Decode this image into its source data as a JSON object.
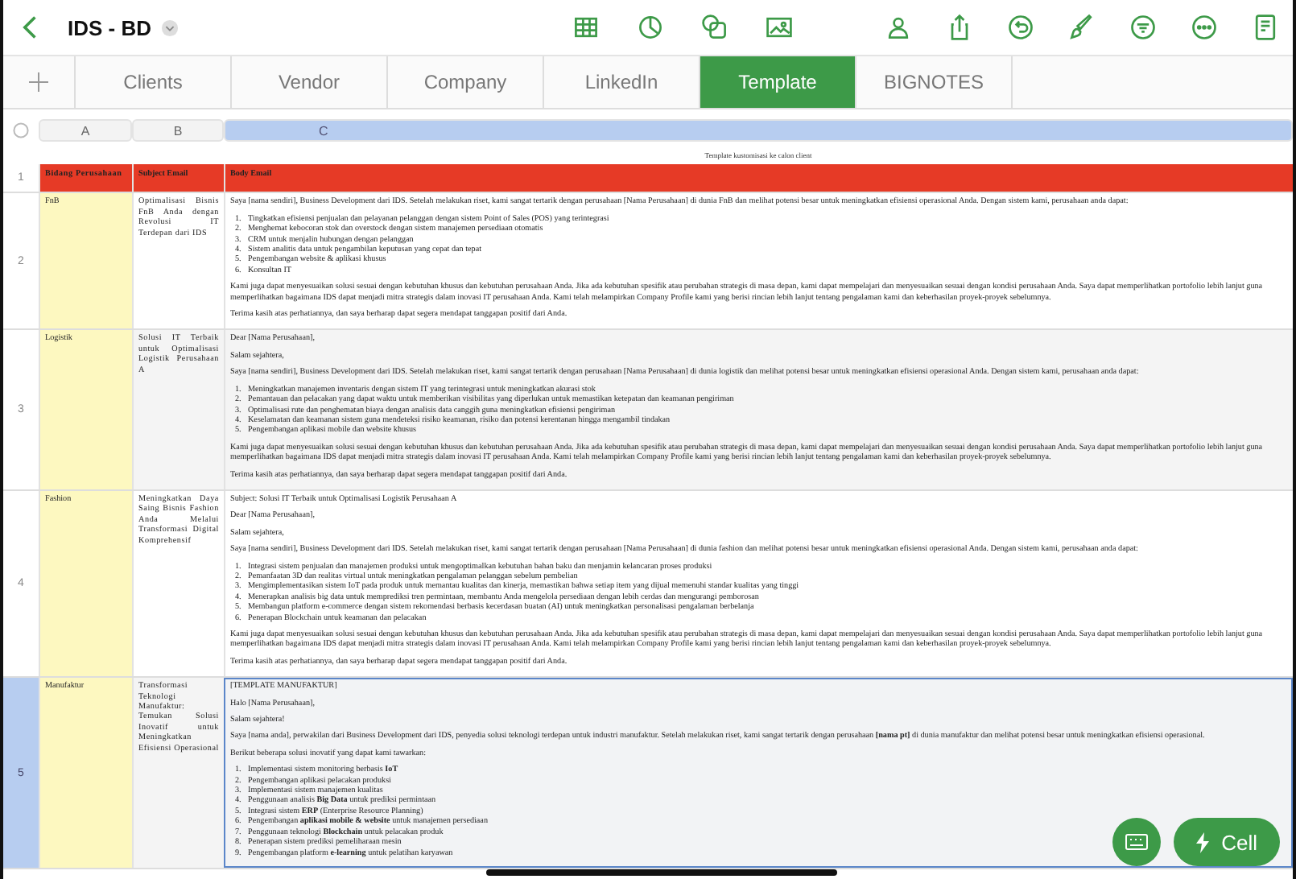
{
  "document": {
    "title": "IDS - BD"
  },
  "tabs": [
    {
      "label": "Clients",
      "selected": false
    },
    {
      "label": "Vendor",
      "selected": false
    },
    {
      "label": "Company",
      "selected": false
    },
    {
      "label": "LinkedIn",
      "selected": false
    },
    {
      "label": "Template",
      "selected": true
    },
    {
      "label": "BIGNOTES",
      "selected": false
    }
  ],
  "columns": [
    {
      "label": "A",
      "selected": false
    },
    {
      "label": "B",
      "selected": false
    },
    {
      "label": "C",
      "selected": true
    }
  ],
  "sheet_title": "Template kustomisasi ke calon client",
  "header": {
    "number": "1",
    "cells": [
      "Bidang Perusahaan",
      "Subject Email",
      "Body Email"
    ]
  },
  "rows": [
    {
      "number": "2",
      "selected": false,
      "editing": false,
      "sector": "FnB",
      "subject": "Optimalisasi Bisnis FnB Anda dengan Revolusi IT Terdepan dari IDS",
      "body": [
        {
          "kind": "para",
          "text": "Saya [nama sendiri], Business Development dari IDS. Setelah melakukan riset, kami sangat tertarik dengan perusahaan [Nama Perusahaan] di dunia FnB dan melihat potensi besar untuk meningkatkan efisiensi operasional Anda. Dengan sistem kami, perusahaan anda dapat:"
        },
        {
          "kind": "list",
          "items": [
            {
              "marker": "1.",
              "text": "Tingkatkan efisiensi penjualan dan pelayanan pelanggan dengan sistem Point of Sales (POS) yang terintegrasi"
            },
            {
              "marker": "2.",
              "text": "Menghemat kebocoran stok dan overstock dengan sistem manajemen persediaan otomatis"
            },
            {
              "marker": "3.",
              "text": "CRM untuk menjalin hubungan dengan pelanggan"
            },
            {
              "marker": "4.",
              "text": "Sistem analitis data untuk pengambilan keputusan yang cepat dan tepat"
            },
            {
              "marker": "5.",
              "text": "Pengembangan website & aplikasi khusus"
            },
            {
              "marker": "6.",
              "text": "Konsultan IT"
            }
          ]
        },
        {
          "kind": "para",
          "text": "Kami juga dapat menyesuaikan solusi sesuai dengan kebutuhan khusus dan kebutuhan perusahaan Anda. Jika ada kebutuhan spesifik atau perubahan strategis di masa depan, kami dapat mempelajari dan menyesuaikan sesuai dengan kondisi perusahaan Anda. Saya dapat memperlihatkan portofolio lebih lanjut guna memperlihatkan bagaimana IDS dapat menjadi mitra strategis dalam inovasi IT perusahaan Anda. Kami telah melampirkan Company Profile kami yang berisi rincian lebih lanjut tentang pengalaman kami dan keberhasilan proyek-proyek sebelumnya."
        },
        {
          "kind": "para",
          "text": "Terima kasih atas perhatiannya, dan saya berharap dapat segera mendapat tanggapan positif dari Anda."
        }
      ]
    },
    {
      "number": "3",
      "selected": false,
      "editing": false,
      "sector": "Logistik",
      "subject": "Solusi IT Terbaik untuk Optimalisasi Logistik Perusahaan A",
      "body": [
        {
          "kind": "para",
          "text": "Dear [Nama Perusahaan],"
        },
        {
          "kind": "para",
          "text": "Salam sejahtera,"
        },
        {
          "kind": "para",
          "text": "Saya [nama sendiri], Business Development dari IDS. Setelah melakukan riset, kami sangat tertarik dengan perusahaan [Nama Perusahaan] di dunia logistik dan melihat potensi besar untuk meningkatkan efisiensi operasional Anda. Dengan sistem kami, perusahaan anda dapat:"
        },
        {
          "kind": "list",
          "items": [
            {
              "marker": "1.",
              "text": "Meningkatkan manajemen inventaris dengan sistem IT yang terintegrasi untuk meningkatkan akurasi stok"
            },
            {
              "marker": "2.",
              "text": "Pemantauan dan pelacakan yang dapat waktu untuk memberikan visibilitas yang diperlukan untuk memastikan ketepatan dan keamanan pengiriman"
            },
            {
              "marker": "3.",
              "text": "Optimalisasi rute dan penghematan biaya dengan analisis data canggih guna meningkatkan efisiensi pengiriman"
            },
            {
              "marker": "4.",
              "text": "Keselamatan dan keamanan sistem guna mendeteksi risiko keamanan, risiko dan potensi kerentanan hingga mengambil tindakan"
            },
            {
              "marker": "5.",
              "text": "Pengembangan aplikasi mobile dan website khusus"
            }
          ]
        },
        {
          "kind": "para",
          "text": "Kami juga dapat menyesuaikan solusi sesuai dengan kebutuhan khusus dan kebutuhan perusahaan Anda. Jika ada kebutuhan spesifik atau perubahan strategis di masa depan, kami dapat mempelajari dan menyesuaikan sesuai dengan kondisi perusahaan Anda. Saya dapat memperlihatkan portofolio lebih lanjut guna memperlihatkan bagaimana IDS dapat menjadi mitra strategis dalam inovasi IT perusahaan Anda. Kami telah melampirkan Company Profile kami yang berisi rincian lebih lanjut tentang pengalaman kami dan keberhasilan proyek-proyek sebelumnya."
        },
        {
          "kind": "para",
          "text": "Terima kasih atas perhatiannya, dan saya berharap dapat segera mendapat tanggapan positif dari Anda."
        }
      ]
    },
    {
      "number": "4",
      "selected": false,
      "editing": false,
      "sector": "Fashion",
      "subject": "Meningkatkan Daya Saing Bisnis Fashion Anda Melalui Transformasi Digital Komprehensif",
      "body": [
        {
          "kind": "para",
          "text": "Subject: Solusi IT Terbaik untuk Optimalisasi Logistik Perusahaan A"
        },
        {
          "kind": "para",
          "text": "Dear [Nama Perusahaan],"
        },
        {
          "kind": "para",
          "text": "Salam sejahtera,"
        },
        {
          "kind": "para",
          "text": "Saya [nama sendiri], Business Development dari IDS. Setelah melakukan riset, kami sangat tertarik dengan perusahaan [Nama Perusahaan] di dunia fashion dan melihat potensi besar untuk meningkatkan efisiensi operasional Anda. Dengan sistem kami, perusahaan anda dapat:"
        },
        {
          "kind": "list",
          "items": [
            {
              "marker": "1.",
              "text": "Integrasi sistem penjualan dan manajemen produksi untuk mengoptimalkan kebutuhan bahan baku dan menjamin kelancaran proses produksi"
            },
            {
              "marker": "2.",
              "text": "Pemanfaatan 3D dan realitas virtual untuk meningkatkan pengalaman pelanggan sebelum pembelian"
            },
            {
              "marker": "3.",
              "text": "Mengimplementasikan sistem IoT pada produk untuk memantau kualitas dan kinerja, memastikan bahwa setiap item yang dijual memenuhi standar kualitas yang tinggi"
            },
            {
              "marker": "4.",
              "text": "Menerapkan analisis big data untuk memprediksi tren permintaan, membantu Anda mengelola persediaan dengan lebih cerdas dan mengurangi pemborosan"
            },
            {
              "marker": "5.",
              "text": "Membangun platform e-commerce dengan sistem rekomendasi berbasis kecerdasan buatan (AI) untuk meningkatkan personalisasi pengalaman berbelanja"
            },
            {
              "marker": "6.",
              "text": "Penerapan Blockchain untuk keamanan dan pelacakan"
            }
          ]
        },
        {
          "kind": "para",
          "text": "Kami juga dapat menyesuaikan solusi sesuai dengan kebutuhan khusus dan kebutuhan perusahaan Anda. Jika ada kebutuhan spesifik atau perubahan strategis di masa depan, kami dapat mempelajari dan menyesuaikan sesuai dengan kondisi perusahaan Anda. Saya dapat memperlihatkan portofolio lebih lanjut guna memperlihatkan bagaimana IDS dapat menjadi mitra strategis dalam inovasi IT perusahaan Anda. Kami telah melampirkan Company Profile kami yang berisi rincian lebih lanjut tentang pengalaman kami dan keberhasilan proyek-proyek sebelumnya."
        },
        {
          "kind": "para",
          "text": "Terima kasih atas perhatiannya, dan saya berharap dapat segera mendapat tanggapan positif dari Anda."
        }
      ]
    },
    {
      "number": "5",
      "selected": true,
      "editing": true,
      "sector": "Manufaktur",
      "subject": "Transformasi Teknologi Manufaktur: Temukan Solusi Inovatif untuk Meningkatkan Efisiensi Operasional",
      "body": [
        {
          "kind": "para",
          "text": "[TEMPLATE MANUFAKTUR]"
        },
        {
          "kind": "para",
          "text": "Halo [Nama Perusahaan],"
        },
        {
          "kind": "para",
          "text": "Salam sejahtera!"
        },
        {
          "kind": "para",
          "text": "Saya [nama anda], perwakilan dari Business Development dari IDS, penyedia solusi teknologi terdepan untuk industri manufaktur. Setelah melakukan riset, kami sangat tertarik dengan perusahaan **[nama pt]** di dunia manufaktur dan melihat potensi besar untuk meningkatkan efisiensi operasional."
        },
        {
          "kind": "para",
          "text": "Berikut beberapa solusi inovatif yang dapat kami tawarkan:"
        },
        {
          "kind": "list",
          "items": [
            {
              "marker": "1.",
              "text": "Implementasi sistem monitoring berbasis **IoT**"
            },
            {
              "marker": "2.",
              "text": "Pengembangan aplikasi pelacakan produksi"
            },
            {
              "marker": "3.",
              "text": "Implementasi sistem manajemen kualitas"
            },
            {
              "marker": "4.",
              "text": "Penggunaan analisis **Big Data** untuk prediksi permintaan"
            },
            {
              "marker": "5.",
              "text": "Integrasi sistem **ERP** (Enterprise Resource Planning)"
            },
            {
              "marker": "6.",
              "text": "Pengembangan **aplikasi mobile & website** untuk manajemen persediaan"
            },
            {
              "marker": "7.",
              "text": "Penggunaan teknologi **Blockchain** untuk pelacakan produk"
            },
            {
              "marker": "8.",
              "text": "Penerapan sistem prediksi pemeliharaan mesin"
            },
            {
              "marker": "9.",
              "text": "Pengembangan platform **e-learning** untuk pelatihan karyawan"
            }
          ]
        }
      ]
    }
  ],
  "cell_button": {
    "label": "Cell"
  }
}
